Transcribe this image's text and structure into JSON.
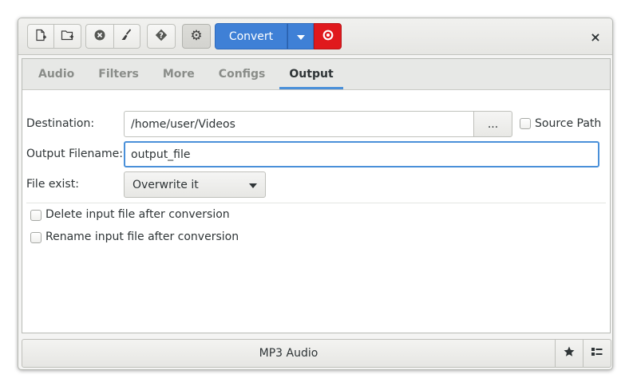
{
  "toolbar": {
    "convert_label": "Convert",
    "close_glyph": "×"
  },
  "tabs": [
    {
      "label": "Audio",
      "active": false
    },
    {
      "label": "Filters",
      "active": false
    },
    {
      "label": "More",
      "active": false
    },
    {
      "label": "Configs",
      "active": false
    },
    {
      "label": "Output",
      "active": true
    }
  ],
  "output": {
    "destination_label": "Destination:",
    "destination_value": "/home/user/Videos",
    "browse_label": "...",
    "source_path_label": "Source Path",
    "source_path_checked": false,
    "filename_label": "Output Filename:",
    "filename_value": "output_file",
    "file_exist_label": "File exist:",
    "file_exist_value": "Overwrite it",
    "delete_input_label": "Delete input file after conversion",
    "delete_input_checked": false,
    "rename_input_label": "Rename input file after conversion",
    "rename_input_checked": false
  },
  "footer": {
    "preset_label": "MP3 Audio"
  },
  "colors": {
    "accent": "#4a90d9",
    "convert_bg": "#3f80d6",
    "stop_bg": "#e0191d"
  },
  "icons": {
    "add_file": "add-file-icon",
    "add_folder": "add-folder-icon",
    "remove": "remove-icon",
    "clear": "brush-icon",
    "help": "help-icon",
    "settings": "gear-icon",
    "dropdown": "chevron-down-icon",
    "stop": "record-stop-icon",
    "favorite": "star-icon",
    "list": "list-icon"
  }
}
